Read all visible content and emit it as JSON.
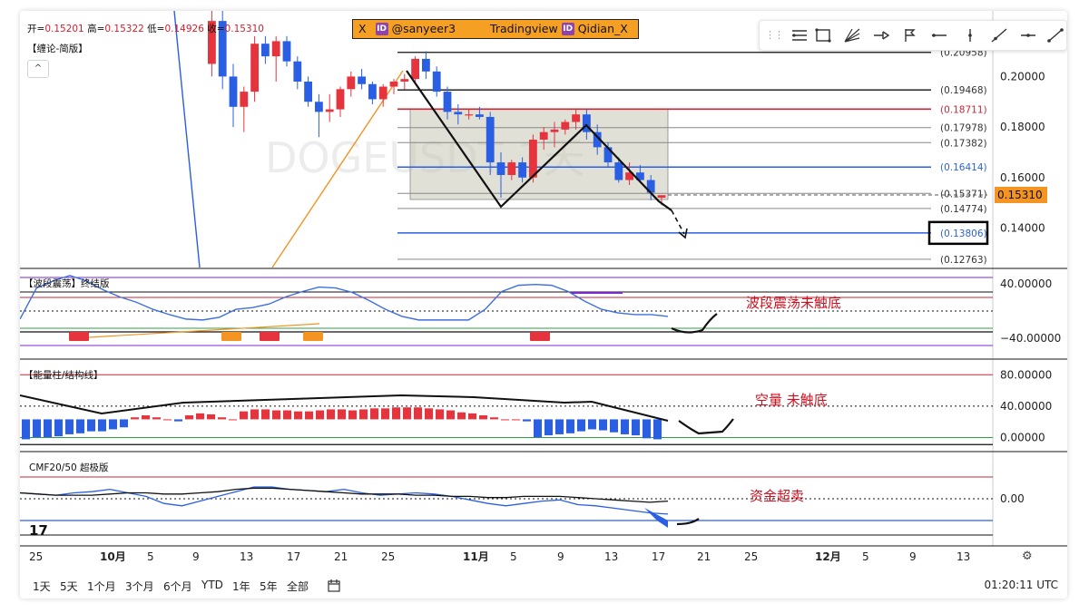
{
  "ohlc": {
    "open_label": "开=",
    "open": "0.15201",
    "high_label": "高=",
    "high": "0.15322",
    "low_label": "低=",
    "low": "0.14926",
    "close_label": "收=",
    "close": "0.15310"
  },
  "panel_titles": {
    "main": "【缠论-简版】",
    "wave": "【波段震荡】终结版",
    "energy": "【能量柱/结构线】",
    "cmf": "CMF20/50 超极版"
  },
  "collapse_button": "^",
  "banner": {
    "x": "X",
    "badge": "ID",
    "handle1": "@sanyeer3",
    "platform": "Tradingview",
    "handle2": "Qidian_X"
  },
  "watermark": "DOGEUSDT 1天",
  "annotations": {
    "wave": "波段震荡未触底",
    "energy": "空量 未触底",
    "cmf": "资金超卖"
  },
  "time_ranges": [
    "1天",
    "5天",
    "1个月",
    "3个月",
    "6个月",
    "YTD",
    "1年",
    "5年",
    "全部"
  ],
  "utc_time": "01:20:11 UTC",
  "colors": {
    "up": "#e5343d",
    "down": "#2a5fe3",
    "wave_line": "#3d6fe0",
    "orange": "#f39423",
    "box": "#c9c6b4",
    "annotation": "#d0101e"
  },
  "chart_data": [
    {
      "type": "candlestick",
      "title": "DOGEUSDT 1天",
      "symbol": "DOGEUSDT",
      "interval": "1天",
      "x_ticks": [
        "25",
        "10月",
        "5",
        "9",
        "13",
        "17",
        "21",
        "25",
        "11月",
        "5",
        "9",
        "13",
        "17",
        "21",
        "25",
        "12月",
        "5",
        "9",
        "13"
      ],
      "ylim": [
        0.124,
        0.226
      ],
      "y_ticks": [
        "0.14000",
        "0.16000",
        "0.18000",
        "0.20000"
      ],
      "last_price": "0.15310",
      "candles": [
        [
          0.205,
          0.228,
          0.2,
          0.222
        ],
        [
          0.222,
          0.226,
          0.195,
          0.2
        ],
        [
          0.2,
          0.205,
          0.18,
          0.188
        ],
        [
          0.188,
          0.196,
          0.178,
          0.194
        ],
        [
          0.194,
          0.216,
          0.19,
          0.213
        ],
        [
          0.213,
          0.216,
          0.205,
          0.208
        ],
        [
          0.208,
          0.216,
          0.198,
          0.214
        ],
        [
          0.214,
          0.216,
          0.204,
          0.206
        ],
        [
          0.206,
          0.208,
          0.195,
          0.198
        ],
        [
          0.198,
          0.2,
          0.188,
          0.19
        ],
        [
          0.19,
          0.193,
          0.176,
          0.186
        ],
        [
          0.186,
          0.193,
          0.182,
          0.187
        ],
        [
          0.187,
          0.196,
          0.184,
          0.195
        ],
        [
          0.195,
          0.202,
          0.192,
          0.2
        ],
        [
          0.2,
          0.203,
          0.195,
          0.197
        ],
        [
          0.197,
          0.198,
          0.189,
          0.191
        ],
        [
          0.191,
          0.197,
          0.188,
          0.196
        ],
        [
          0.196,
          0.199,
          0.193,
          0.198
        ],
        [
          0.198,
          0.201,
          0.195,
          0.199
        ],
        [
          0.199,
          0.208,
          0.197,
          0.207
        ],
        [
          0.207,
          0.21,
          0.199,
          0.202
        ],
        [
          0.202,
          0.204,
          0.192,
          0.194
        ],
        [
          0.194,
          0.196,
          0.183,
          0.186
        ],
        [
          0.186,
          0.189,
          0.181,
          0.185
        ],
        [
          0.185,
          0.187,
          0.183,
          0.185
        ],
        [
          0.185,
          0.188,
          0.183,
          0.184
        ],
        [
          0.184,
          0.186,
          0.161,
          0.166
        ],
        [
          0.166,
          0.17,
          0.152,
          0.161
        ],
        [
          0.161,
          0.167,
          0.159,
          0.166
        ],
        [
          0.166,
          0.168,
          0.158,
          0.16
        ],
        [
          0.16,
          0.177,
          0.158,
          0.175
        ],
        [
          0.175,
          0.18,
          0.171,
          0.178
        ],
        [
          0.178,
          0.182,
          0.172,
          0.179
        ],
        [
          0.179,
          0.183,
          0.177,
          0.182
        ],
        [
          0.182,
          0.187,
          0.179,
          0.185
        ],
        [
          0.185,
          0.187,
          0.175,
          0.178
        ],
        [
          0.178,
          0.181,
          0.169,
          0.172
        ],
        [
          0.172,
          0.174,
          0.164,
          0.166
        ],
        [
          0.166,
          0.168,
          0.158,
          0.159
        ],
        [
          0.159,
          0.166,
          0.157,
          0.162
        ],
        [
          0.162,
          0.165,
          0.158,
          0.159
        ],
        [
          0.159,
          0.161,
          0.151,
          0.154
        ],
        [
          0.152,
          0.153,
          0.149,
          0.153
        ]
      ],
      "fib_levels": [
        {
          "value": 0.20958,
          "label": "(0.20958)"
        },
        {
          "value": 0.19468,
          "label": "(0.19468)"
        },
        {
          "value": 0.18711,
          "label": "(0.18711)"
        },
        {
          "value": 0.17978,
          "label": "(0.17978)"
        },
        {
          "value": 0.17382,
          "label": "(0.17382)"
        },
        {
          "value": 0.16414,
          "label": "(0.16414)"
        },
        {
          "value": 0.15371,
          "label": "(0.15371)"
        },
        {
          "value": 0.14774,
          "label": "(0.14774)"
        },
        {
          "value": 0.13806,
          "label": "(0.13806)"
        },
        {
          "value": 0.12763,
          "label": "(0.12763)"
        }
      ]
    },
    {
      "type": "line",
      "title": "【波段震荡】终结版",
      "ylim": [
        -50,
        52
      ],
      "y_ticks": [
        "40.00000",
        "−40.00000"
      ],
      "values": [
        -5,
        30,
        38,
        44,
        38,
        28,
        20,
        14,
        6,
        0,
        -5,
        -6,
        -3,
        6,
        8,
        12,
        20,
        26,
        31,
        30,
        25,
        16,
        6,
        -2,
        -6,
        -6,
        -6,
        -6,
        6,
        26,
        33,
        34,
        33,
        26,
        15,
        6,
        2,
        0,
        0,
        -2
      ]
    },
    {
      "type": "bar",
      "title": "【能量柱/结构线】",
      "ylim": [
        -18,
        100
      ],
      "y_ticks": [
        "80.00000",
        "40.00000",
        "0.00000"
      ],
      "values": [
        -20,
        -18,
        -18,
        -17,
        -15,
        -14,
        -12,
        -12,
        -10,
        -8,
        2,
        4,
        2,
        0,
        -2,
        4,
        6,
        5,
        2,
        0,
        8,
        10,
        10,
        9,
        9,
        8,
        8,
        9,
        10,
        10,
        9,
        10,
        11,
        11,
        12,
        12,
        12,
        11,
        10,
        9,
        7,
        6,
        4,
        2,
        0,
        0,
        -2,
        -18,
        -16,
        -15,
        -14,
        -12,
        -10,
        -11,
        -13,
        -15,
        -16,
        -19,
        -20
      ]
    },
    {
      "type": "line",
      "title": "CMF20/50 超极版",
      "y_ticks": [
        "0.00"
      ],
      "series": [
        {
          "values": [
            0.05,
            0.04,
            0.03,
            0.05,
            0.06,
            0.08,
            0.05,
            0.02,
            -0.04,
            -0.06,
            -0.02,
            0.02,
            0.06,
            0.1,
            0.1,
            0.08,
            0.07,
            0.06,
            0.08,
            0.05,
            0.03,
            0.04,
            0.05,
            0.04,
            0.02,
            -0.01,
            -0.04,
            -0.06,
            -0.04,
            -0.02,
            -0.01,
            -0.05,
            -0.06,
            -0.08,
            -0.1,
            -0.12,
            -0.13
          ]
        },
        {
          "values": [
            0.05,
            0.04,
            0.03,
            0.03,
            0.03,
            0.04,
            0.05,
            0.05,
            0.04,
            0.04,
            0.05,
            0.06,
            0.08,
            0.09,
            0.09,
            0.08,
            0.07,
            0.06,
            0.05,
            0.04,
            0.04,
            0.04,
            0.03,
            0.03,
            0.02,
            0.02,
            0.01,
            0.01,
            0.02,
            0.02,
            0.02,
            0.01,
            0.0,
            -0.01,
            -0.02,
            -0.03,
            -0.02
          ]
        }
      ]
    }
  ]
}
